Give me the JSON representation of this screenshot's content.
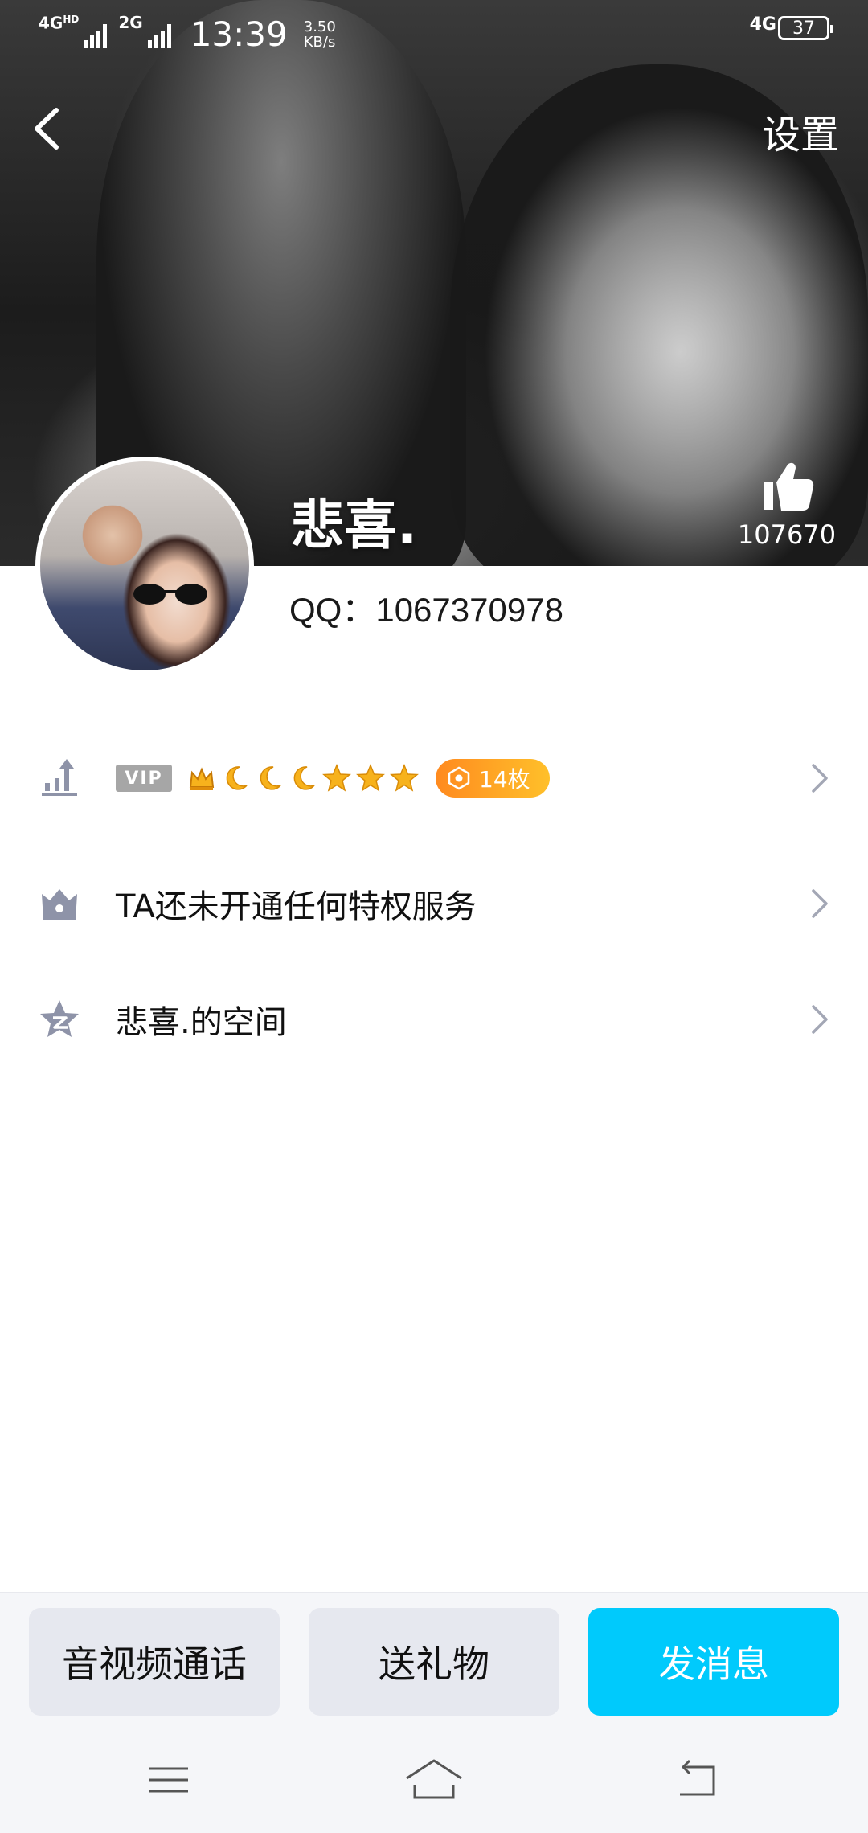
{
  "status_bar": {
    "network_1": "4G",
    "network_1_sub": "HD",
    "network_2": "2G",
    "time": "13:39",
    "speed_value": "3.50",
    "speed_unit": "KB/s",
    "network_right": "4G",
    "battery": "37"
  },
  "header": {
    "back_icon": "chevron-left-icon",
    "settings_label": "设置"
  },
  "profile": {
    "nickname": "悲喜.",
    "like_count": "107670",
    "qq_label": "QQ：1067370978"
  },
  "rows": {
    "level": {
      "icon": "level-chart-icon",
      "vip_badge": "VIP",
      "level_icons": [
        "crown",
        "moon",
        "moon",
        "moon",
        "star",
        "star",
        "star"
      ],
      "medal_count": "14枚"
    },
    "privilege": {
      "icon": "privilege-crown-icon",
      "label": "TA还未开通任何特权服务"
    },
    "space": {
      "icon": "qzone-star-icon",
      "label": "悲喜.的空间"
    }
  },
  "actions": {
    "call_label": "音视频通话",
    "gift_label": "送礼物",
    "message_label": "发消息"
  },
  "colors": {
    "primary_button": "#00cafc",
    "secondary_button": "#e6e8ef",
    "medal_gradient_start": "#ff8a1f",
    "medal_gradient_end": "#ffc02a",
    "icon_grey": "#8e93a8"
  }
}
